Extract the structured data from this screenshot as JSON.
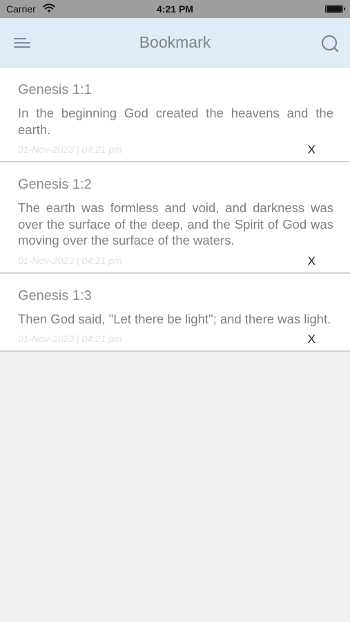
{
  "status": {
    "carrier": "Carrier",
    "time": "4:21 PM"
  },
  "nav": {
    "title": "Bookmark",
    "menu_icon": "menu-icon",
    "search_icon": "search-icon"
  },
  "bookmarks": [
    {
      "ref": "Genesis 1:1",
      "text": "In the beginning God created the heavens and the earth.",
      "date": "01-Nov-2023 | 04:21 pm",
      "delete_label": "X"
    },
    {
      "ref": "Genesis 1:2",
      "text": "The earth was formless and void, and darkness was over the surface of the deep, and the Spirit of God was moving over the surface of the waters.",
      "date": "01-Nov-2023 | 04:21 pm",
      "delete_label": "X"
    },
    {
      "ref": "Genesis 1:3",
      "text": "Then God said, \"Let there be light\"; and there was light.",
      "date": "01-Nov-2023 | 04:21 pm",
      "delete_label": "X"
    }
  ]
}
